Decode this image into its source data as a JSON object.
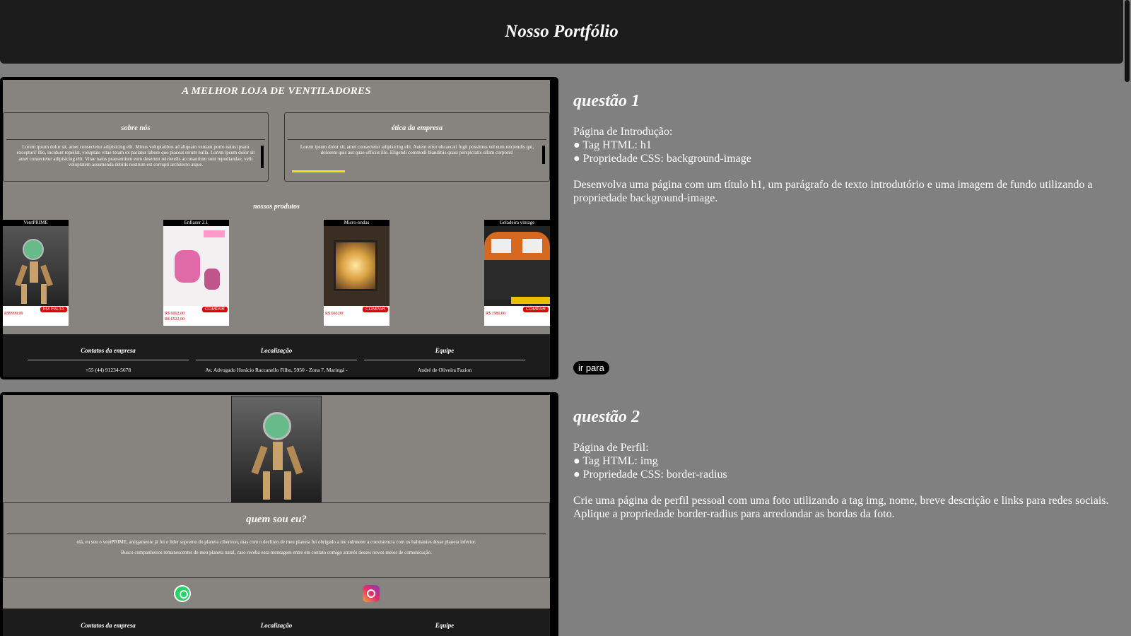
{
  "header": {
    "title": "Nosso Portfólio"
  },
  "q1": {
    "preview": {
      "title": "A MELHOR LOJA DE VENTILADORES",
      "box1_title": "sobre nós",
      "box1_text": "Lorem ipsum dolor sit, amet consectetur adipisicing elit. Minus voluptatibus ad aliquam veniam porro natus ipsam excepturi! Illo, incidunt repellat, voluptate vitae totam ex pariatur labore quo placeat rerum nulla. Lorem ipsum dolor sit amet consectetur adipisicing elit. Vitae natus praesentium eum deserunt reiciendis accusantium sunt repudiandae, velit voluptatem assumenda debitis nostrum est corrupti architecto atque.",
      "box2_title": "ética da empresa",
      "box2_text": "Lorem ipsum dolor sit, amet consectetur adipisicing elit. Autem error obcaecati fugit possimus vel eum reiciendis qui, dolorem quis aut quae officiis illo. Eligendi commodi blanditiis quasi perspiciatis ullam corporis!",
      "products_title": "nossos produtos",
      "products": [
        {
          "name": "VentPRIME",
          "price": "R$9999,99",
          "price2": "",
          "button": "EM FALTA"
        },
        {
          "name": "Enfiaser 2.1",
          "price": "R$ 6002,00",
          "price2": "R$ 6522,00",
          "button": "COMPAR"
        },
        {
          "name": "Micro-ondas",
          "price": "R$ 666,00",
          "price2": "",
          "button": "COMPAR"
        },
        {
          "name": "Geladeira vintage",
          "price": "R$ 1980,00",
          "price2": "",
          "button": "COMPAR"
        }
      ],
      "footer": [
        {
          "title": "Contatos da empresa",
          "text": "+55 (44) 91234-5678"
        },
        {
          "title": "Localização",
          "text": "Av. Advogado Horácio Raccanello Filho, 5950 - Zona 7, Maringá -"
        },
        {
          "title": "Equipe",
          "text": "André de Oliveira Fazion"
        }
      ]
    },
    "heading": "questão 1",
    "intro_line1": "Página de Introdução:",
    "intro_line2": "● Tag HTML: h1",
    "intro_line3": "● Propriedade CSS: background-image",
    "description": "Desenvolva uma página com um título h1, um parágrafo de texto introdutório e uma imagem de fundo utilizando a propriedade background-image.",
    "button": "ir para"
  },
  "q2": {
    "preview": {
      "title": "quem sou eu?",
      "line1": "olá, eu sou o ventPRIME, antigamente já fui o líder supremo do planeta cibertron, mas com o declínio de meu planeta fui obrigado a me submeter a coexistencia com os habitantes desse planeta inferior.",
      "line2": "Busco companheiros remanescentes de meu planeta natal, caso receba essa mensagem entre em contato comigo através desses novos meios de comunicação.",
      "footer": [
        {
          "title": "Contatos da empresa"
        },
        {
          "title": "Localização"
        },
        {
          "title": "Equipe"
        }
      ]
    },
    "heading": "questão 2",
    "intro_line1": "Página de Perfil:",
    "intro_line2": "● Tag HTML: img",
    "intro_line3": "● Propriedade CSS: border-radius",
    "description": "Crie uma página de perfil pessoal com uma foto utilizando a tag img, nome, breve descrição e links para redes sociais. Aplique a propriedade border-radius para arredondar as bordas da foto."
  }
}
